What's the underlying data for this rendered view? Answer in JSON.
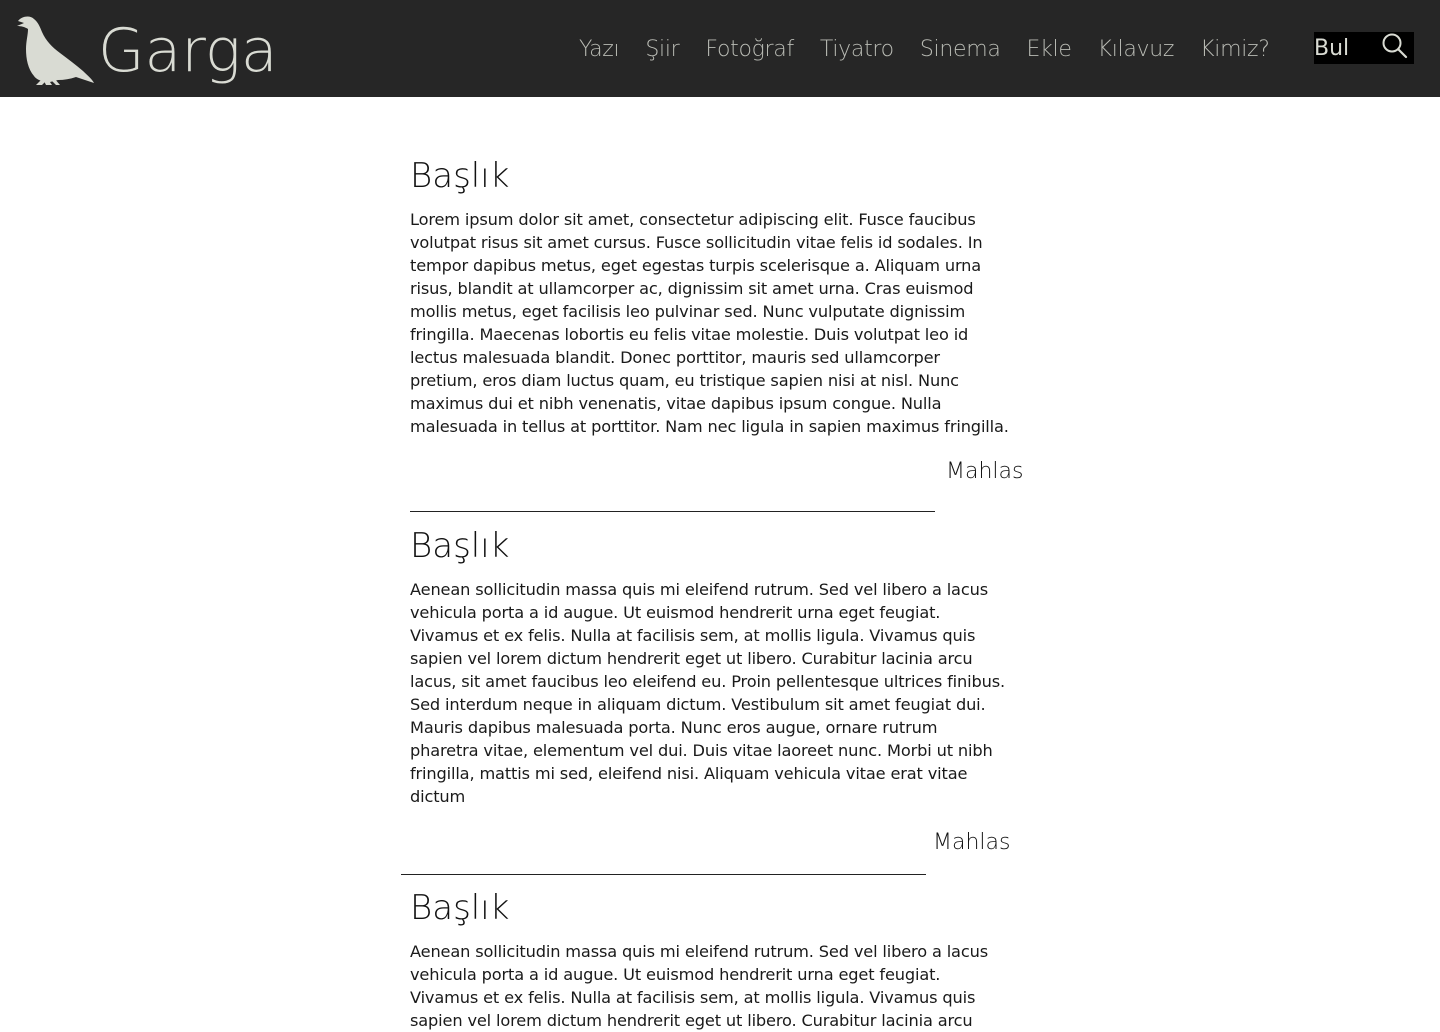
{
  "site": {
    "name": "Garga",
    "logo_icon": "crow-icon"
  },
  "nav": {
    "items": [
      {
        "label": "Yazı"
      },
      {
        "label": "Şiir"
      },
      {
        "label": "Fotoğraf"
      },
      {
        "label": "Tiyatro"
      },
      {
        "label": "Sinema"
      },
      {
        "label": "Ekle"
      },
      {
        "label": "Kılavuz"
      },
      {
        "label": "Kimiz?"
      }
    ]
  },
  "search": {
    "placeholder": "Bul",
    "icon": "search-icon"
  },
  "articles": [
    {
      "title": "Başlık",
      "body": "Lorem ipsum dolor sit amet, consectetur adipiscing elit. Fusce faucibus volutpat risus sit amet cursus. Fusce sollicitudin vitae felis id sodales. In tempor dapibus metus, eget egestas turpis scelerisque a. Aliquam urna risus, blandit at ullamcorper ac, dignissim sit amet urna. Cras euismod mollis metus, eget facilisis leo pulvinar sed. Nunc vulputate dignissim fringilla. Maecenas lobortis eu felis vitae molestie. Duis volutpat leo id lectus malesuada blandit. Donec porttitor, mauris sed ullamcorper pretium, eros diam luctus quam, eu tristique sapien nisi at nisl. Nunc maximus dui et nibh venenatis, vitae dapibus ipsum congue. Nulla malesuada in tellus at porttitor. Nam nec ligula in sapien maximus fringilla.",
      "author": "Mahlas"
    },
    {
      "title": "Başlık",
      "body": "Aenean sollicitudin massa quis mi eleifend rutrum. Sed vel libero a lacus vehicula porta a id augue. Ut euismod hendrerit urna eget feugiat. Vivamus et ex felis. Nulla at facilisis sem, at mollis ligula. Vivamus quis sapien vel lorem dictum hendrerit eget ut libero. Curabitur lacinia arcu lacus, sit amet faucibus leo eleifend eu. Proin pellentesque ultrices finibus. Sed interdum neque in aliquam dictum. Vestibulum sit amet feugiat dui. Mauris dapibus malesuada porta. Nunc eros augue, ornare rutrum pharetra vitae, elementum vel dui. Duis vitae laoreet nunc. Morbi ut nibh fringilla, mattis mi sed, eleifend nisi. Aliquam vehicula vitae erat vitae dictum",
      "author": "Mahlas"
    },
    {
      "title": "Başlık",
      "body": "Aenean sollicitudin massa quis mi eleifend rutrum. Sed vel libero a lacus vehicula porta a id augue. Ut euismod hendrerit urna eget feugiat. Vivamus et ex felis. Nulla at facilisis sem, at mollis ligula. Vivamus quis sapien vel lorem dictum hendrerit eget ut libero. Curabitur lacinia arcu"
    }
  ]
}
